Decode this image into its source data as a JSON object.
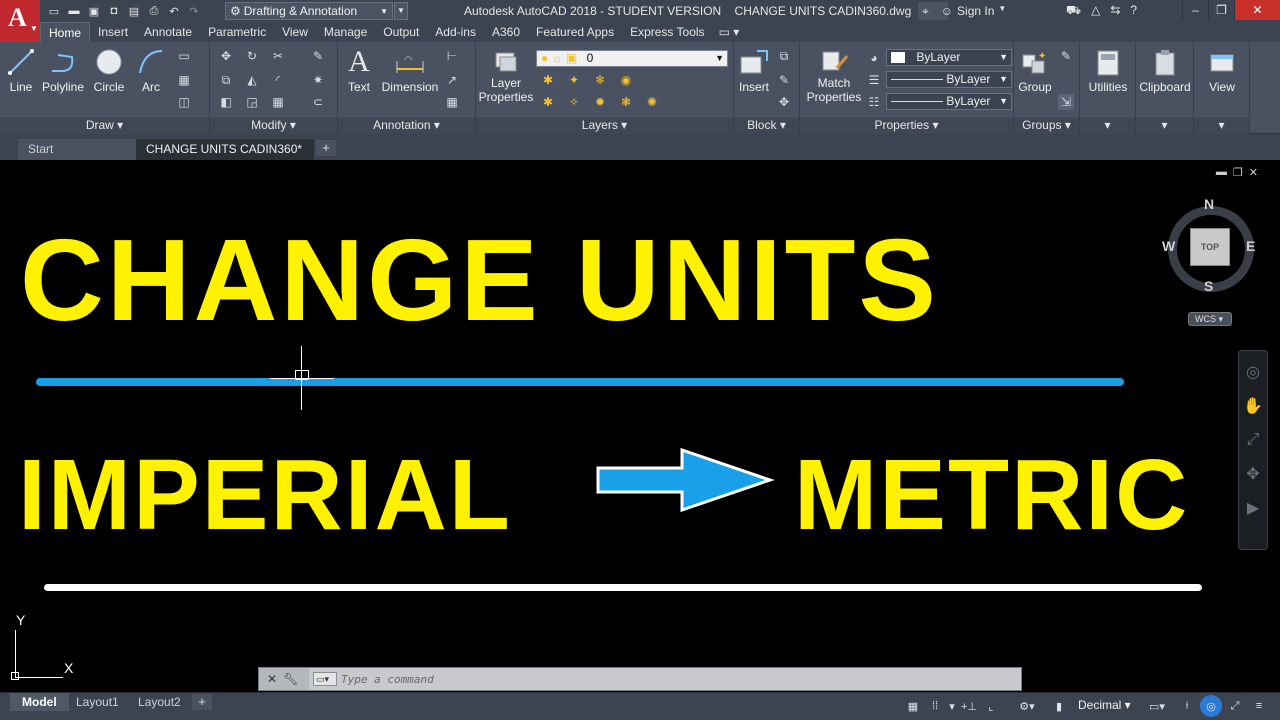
{
  "titlebar": {
    "workspace": "Drafting & Annotation",
    "window_title": "Autodesk AutoCAD 2018 - STUDENT VERSION    CHANGE UNITS CADIN360.dwg",
    "sign_in": "Sign In"
  },
  "ribbon_tabs": [
    "Home",
    "Insert",
    "Annotate",
    "Parametric",
    "View",
    "Manage",
    "Output",
    "Add-ins",
    "A360",
    "Featured Apps",
    "Express Tools"
  ],
  "draw": {
    "title": "Draw",
    "line": "Line",
    "polyline": "Polyline",
    "circle": "Circle",
    "arc": "Arc"
  },
  "modify": {
    "title": "Modify"
  },
  "annotation": {
    "title": "Annotation",
    "text": "Text",
    "dimension": "Dimension"
  },
  "layers": {
    "title": "Layers",
    "layer_properties_1": "Layer",
    "layer_properties_2": "Properties",
    "current_layer": "0"
  },
  "block": {
    "title": "Block",
    "insert": "Insert"
  },
  "properties": {
    "title": "Properties",
    "match_1": "Match",
    "match_2": "Properties",
    "color": "ByLayer",
    "linetype": "ByLayer",
    "lineweight": "ByLayer"
  },
  "groups": {
    "title": "Groups",
    "group": "Group"
  },
  "utilities": {
    "label": "Utilities"
  },
  "clipboard": {
    "label": "Clipboard"
  },
  "view_panel": {
    "label": "View"
  },
  "doc_tabs": {
    "start": "Start",
    "active": "CHANGE UNITS CADIN360*"
  },
  "canvas": {
    "headline": "CHANGE UNITS",
    "from": "IMPERIAL",
    "to": "METRIC",
    "colors": {
      "headline": "#fff200",
      "blue_line": "#1b9ee6",
      "arrow": "#1aa0e8"
    }
  },
  "viewcube": {
    "north": "N",
    "south": "S",
    "east": "E",
    "west": "W",
    "face": "TOP",
    "wcs": "WCS"
  },
  "ucs": {
    "x": "X",
    "y": "Y"
  },
  "command": {
    "placeholder": "Type a command"
  },
  "layout_tabs": {
    "model": "Model",
    "layout1": "Layout1",
    "layout2": "Layout2"
  },
  "status": {
    "units": "Decimal"
  }
}
